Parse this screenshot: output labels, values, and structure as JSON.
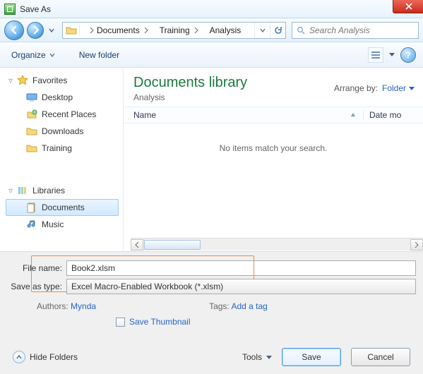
{
  "window": {
    "title": "Save As"
  },
  "breadcrumb": {
    "items": [
      "Documents",
      "Training",
      "Analysis"
    ]
  },
  "search": {
    "placeholder_prefix": "Search",
    "placeholder": "Search Analysis"
  },
  "toolbar": {
    "organize": "Organize",
    "newfolder": "New folder"
  },
  "sidebar": {
    "favorites": {
      "label": "Favorites",
      "items": [
        "Desktop",
        "Recent Places",
        "Downloads",
        "Training"
      ]
    },
    "libraries": {
      "label": "Libraries",
      "items": [
        "Documents",
        "Music"
      ]
    }
  },
  "library": {
    "title": "Documents library",
    "subtitle": "Analysis",
    "arrange_label": "Arrange by:",
    "arrange_value": "Folder"
  },
  "columns": {
    "name": "Name",
    "datemod": "Date mo"
  },
  "empty_msg": "No items match your search.",
  "form": {
    "filename_label": "File name:",
    "filename_value": "Book2.xlsm",
    "savetype_label": "Save as type:",
    "savetype_value": "Excel Macro-Enabled Workbook (*.xlsm)",
    "authors_label": "Authors:",
    "authors_value": "Mynda",
    "tags_label": "Tags:",
    "tags_value": "Add a tag",
    "thumb": "Save Thumbnail"
  },
  "footer": {
    "hidefolders": "Hide Folders",
    "tools": "Tools",
    "save": "Save",
    "cancel": "Cancel"
  }
}
